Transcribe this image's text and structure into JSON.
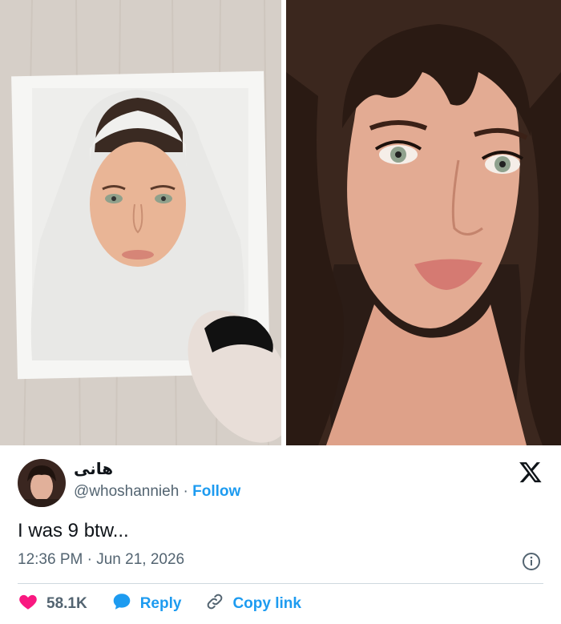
{
  "tweet": {
    "display_name": "هانی",
    "handle": "@whoshannieh",
    "separator": "·",
    "follow_label": "Follow",
    "text": "I was 9 btw...",
    "timestamp": "12:36 PM · Jun 21, 2026",
    "actions": {
      "likes_count": "58.1K",
      "reply_label": "Reply",
      "copy_link_label": "Copy link"
    }
  },
  "colors": {
    "link_blue": "#1d9bf0",
    "like_pink": "#f91880",
    "muted_gray": "#536471",
    "text_dark": "#0f1419"
  },
  "icons": [
    "x-logo-icon",
    "info-icon",
    "heart-icon",
    "reply-bubble-icon",
    "link-icon"
  ]
}
